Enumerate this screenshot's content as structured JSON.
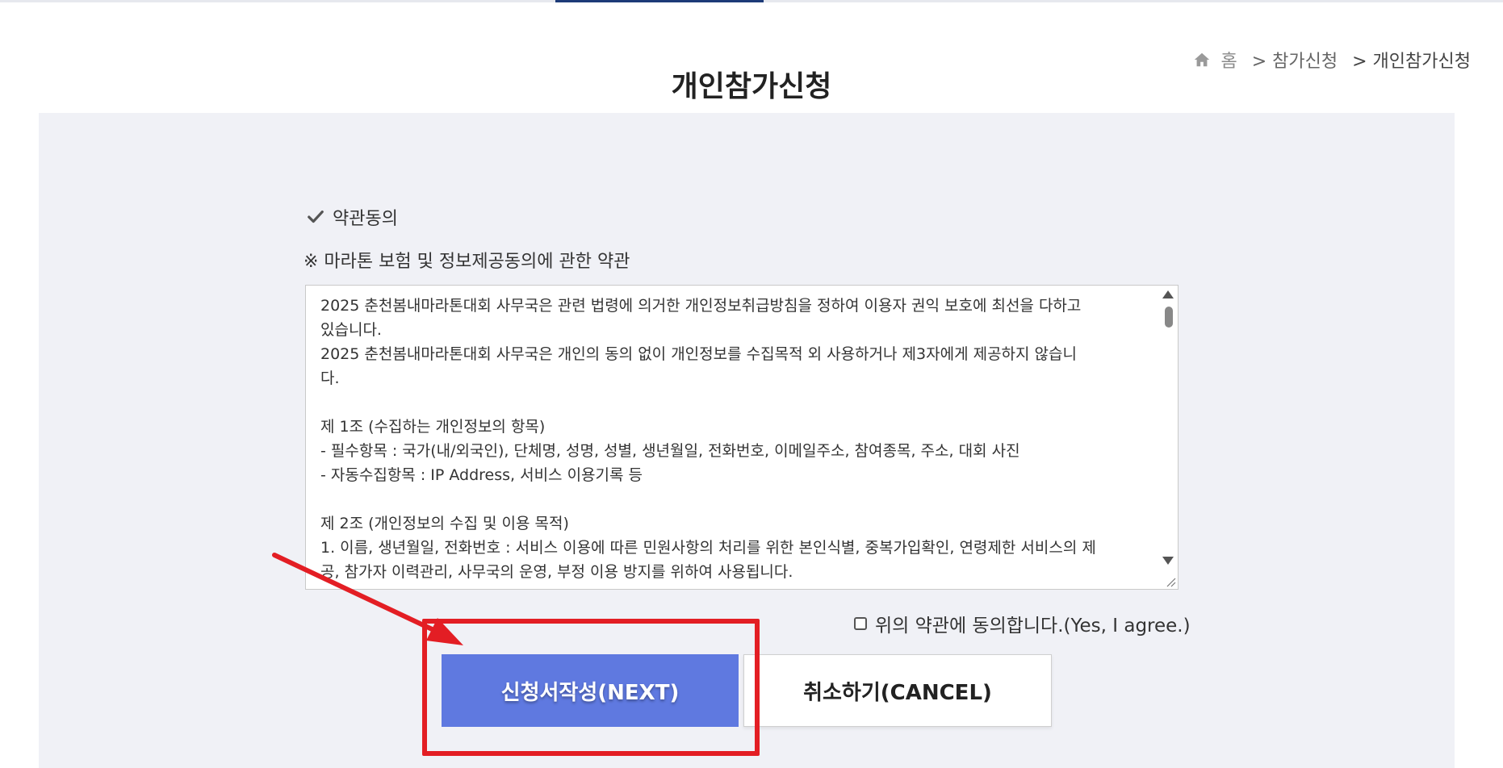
{
  "nav": {
    "active_tab_indicator": "#1d3b78"
  },
  "breadcrumb": {
    "home": "홈",
    "items": [
      "> 참가신청",
      "> 개인참가신청"
    ]
  },
  "page_title": "개인참가신청",
  "section": {
    "title": "약관동의",
    "subtitle": "※ 마라톤 보험 및 정보제공동의에 관한 약관"
  },
  "terms": {
    "text": "2025 춘천봄내마라톤대회 사무국은 관련 법령에 의거한 개인정보취급방침을 정하여 이용자 권익 보호에 최선을 다하고\n있습니다.\n2025 춘천봄내마라톤대회 사무국은 개인의 동의 없이 개인정보를 수집목적 외 사용하거나 제3자에게 제공하지 않습니\n다.\n\n제 1조 (수집하는 개인정보의 항목)\n- 필수항목 : 국가(내/외국인), 단체명, 성명, 성별, 생년월일, 전화번호, 이메일주소, 참여종목, 주소, 대회 사진\n- 자동수집항목 : IP Address, 서비스 이용기록 등\n\n제 2조 (개인정보의 수집 및 이용 목적)\n1. 이름, 생년월일, 전화번호 : 서비스 이용에 따른 민원사항의 처리를 위한 본인식별, 중복가입확인, 연령제한 서비스의 제\n공, 참가자 이력관리, 사무국의 운영, 부정 이용 방지를 위하여 사용됩니다."
  },
  "agree": {
    "label": "위의 약관에 동의합니다.(Yes, I agree.)",
    "checked": false
  },
  "buttons": {
    "next": "신청서작성(NEXT)",
    "cancel": "취소하기(CANCEL)"
  },
  "colors": {
    "accent": "#5f79e0",
    "annotation": "#e31e24",
    "panel_bg": "#f0f1f6"
  }
}
